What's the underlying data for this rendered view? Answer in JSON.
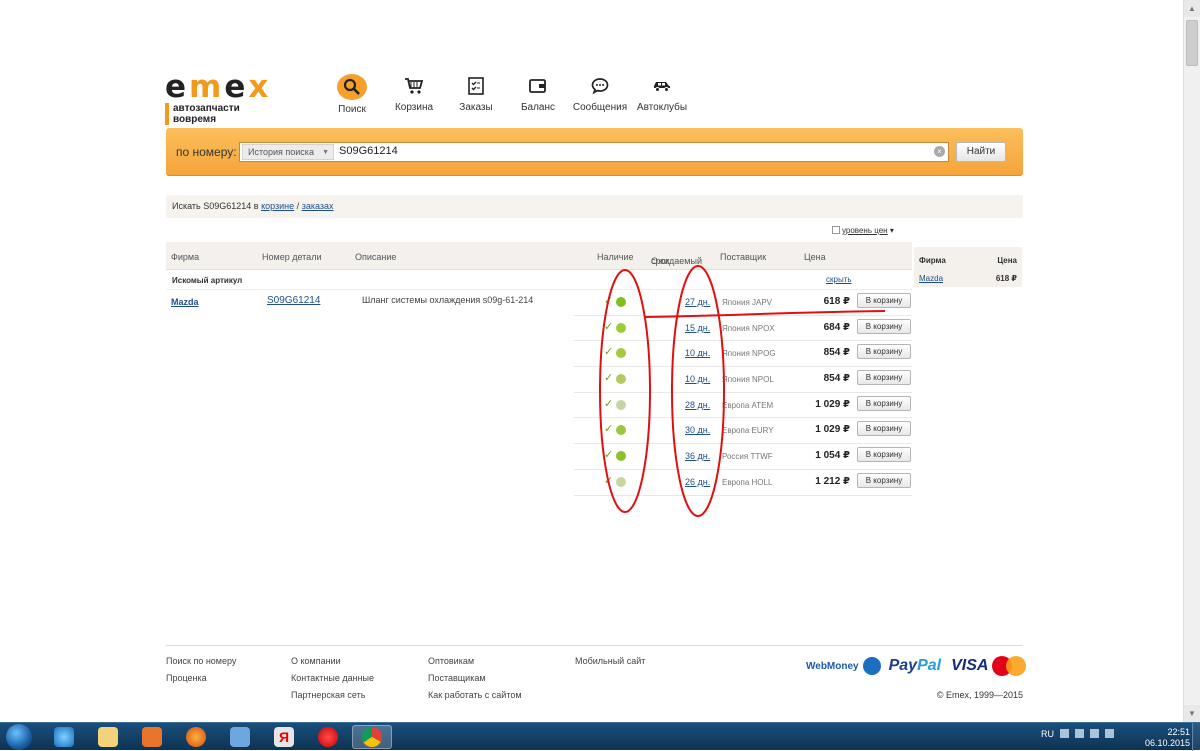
{
  "brand": {
    "logo_text": "EMEX",
    "tagline": "автозапчасти вовремя",
    "accent": "#f39a1c"
  },
  "nav": [
    {
      "label": "Поиск",
      "icon": "search-icon",
      "active": true
    },
    {
      "label": "Корзина",
      "icon": "cart-icon"
    },
    {
      "label": "Заказы",
      "icon": "orders-checklist-icon"
    },
    {
      "label": "Баланс",
      "icon": "wallet-icon"
    },
    {
      "label": "Сообщения",
      "icon": "chat-bubble-icon"
    },
    {
      "label": "Автоклубы",
      "icon": "car-icon"
    }
  ],
  "search": {
    "label": "по номеру:",
    "history_label": "История поиска",
    "query": "S09G61214",
    "submit_label": "Найти"
  },
  "breadcrumb": {
    "prefix": "Искать S09G61214 в",
    "link_cart": "корзине",
    "separator": "/",
    "link_orders": "заказах"
  },
  "price_level_label": "уровень цен",
  "table": {
    "headers": {
      "firm": "Фирма",
      "part_number": "Номер детали",
      "description": "Описание",
      "availability": "Наличие",
      "delivery_line1": "Ожидаемый",
      "delivery_line2": "срок",
      "supplier": "Поставщик",
      "price": "Цена"
    },
    "section_title": "Искомый артикул",
    "hide_label": "скрыть",
    "part": {
      "firm": "Mazda",
      "number": "S09G61214",
      "description": "Шланг системы охлаждения s09g-61-214"
    },
    "cart_label": "В корзину",
    "rows": [
      {
        "days": "27 дн.",
        "supplier": "Япония JAPV",
        "price": "618 ₽",
        "dot": "#7fbf1f"
      },
      {
        "days": "15 дн.",
        "supplier": "Япония NPOX",
        "price": "684 ₽",
        "dot": "#9ccc3c"
      },
      {
        "days": "10 дн.",
        "supplier": "Япония NPOG",
        "price": "854 ₽",
        "dot": "#a8c83e"
      },
      {
        "days": "10 дн.",
        "supplier": "Япония NPOL",
        "price": "854 ₽",
        "dot": "#b5c95e"
      },
      {
        "days": "28 дн.",
        "supplier": "Европа ATEM",
        "price": "1 029 ₽",
        "dot": "#c8d4a6"
      },
      {
        "days": "30 дн.",
        "supplier": "Европа EURY",
        "price": "1 029 ₽",
        "dot": "#9cc640"
      },
      {
        "days": "36 дн.",
        "supplier": "Россия TTWF",
        "price": "1 054 ₽",
        "dot": "#8cc02c"
      },
      {
        "days": "26 дн.",
        "supplier": "Европа HOLL",
        "price": "1 212 ₽",
        "dot": "#c9d6a0"
      }
    ]
  },
  "side_panel": {
    "header_firm": "Фирма",
    "header_price": "Цена",
    "firm": "Mazda",
    "price": "618 ₽"
  },
  "footer": {
    "col1": [
      "Поиск по номеру",
      "Проценка"
    ],
    "col2": [
      "О компании",
      "Контактные данные",
      "Партнерская сеть"
    ],
    "col3": [
      "Оптовикам",
      "Поставщикам",
      "Как работать с сайтом"
    ],
    "col4": [
      "Мобильный сайт"
    ],
    "payments": {
      "webmoney": "WebMoney",
      "paypal_a": "Pay",
      "paypal_b": "Pal",
      "visa": "VISA",
      "mastercard": "MasterCard"
    },
    "copyright": "© Emex, 1999—2015"
  },
  "taskbar": {
    "lang": "RU",
    "time": "22:51",
    "date": "06.10.2015"
  }
}
